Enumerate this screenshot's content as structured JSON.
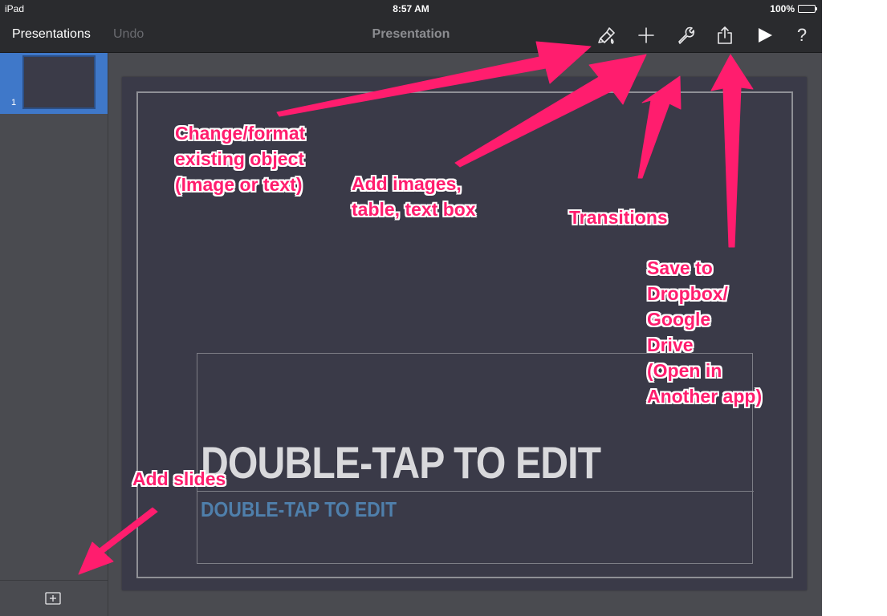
{
  "status_bar": {
    "device": "iPad",
    "time": "8:57 AM",
    "battery": "100%",
    "battery_level": 1.0
  },
  "toolbar": {
    "presentations_label": "Presentations",
    "undo_label": "Undo",
    "title": "Presentation",
    "icons": [
      "paintbrush-icon",
      "plus-icon",
      "wrench-icon",
      "share-icon",
      "play-icon",
      "help-icon"
    ],
    "help_glyph": "?"
  },
  "sidebar": {
    "slides": [
      {
        "number": "1"
      }
    ]
  },
  "slide": {
    "title": "DOUBLE-TAP TO EDIT",
    "subtitle": "DOUBLE-TAP TO EDIT"
  },
  "annotations": {
    "format": "Change/format\nexisting object\n(Image or text)",
    "add_images": "Add images,\ntable, text box",
    "transitions": "Transitions",
    "save": "Save to\nDropbox/\nGoogle\nDrive\n(Open in\nAnother app)",
    "add_slides": "Add slides"
  },
  "colors": {
    "annotation": "#ff1d6e",
    "toolbar": "#2a2b2e",
    "selection": "#3f78c9",
    "slide_background": "#3a3a48",
    "subtitle": "#4f7fab"
  }
}
